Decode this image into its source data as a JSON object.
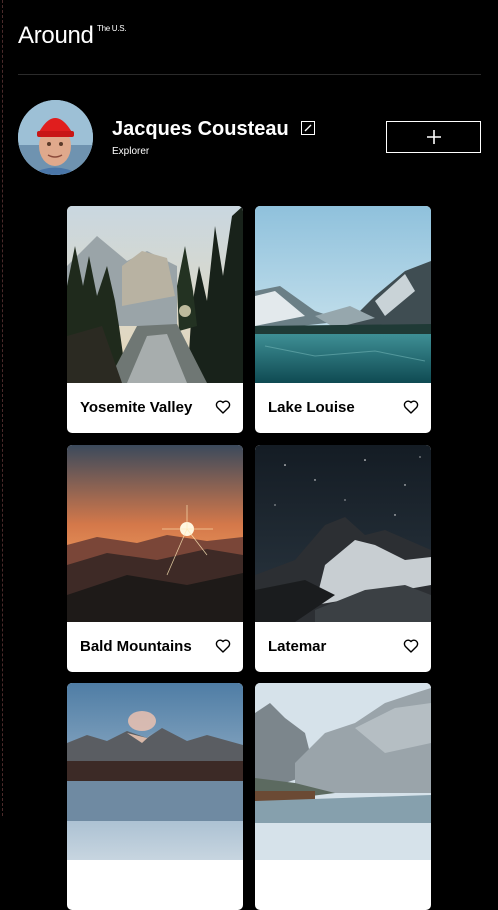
{
  "header": {
    "logo": "Around",
    "logo_sup": "The U.S."
  },
  "profile": {
    "name": "Jacques Cousteau",
    "role": "Explorer",
    "edit_icon": "edit-icon",
    "add_icon": "plus-icon"
  },
  "cards": [
    {
      "title": "Yosemite Valley",
      "like_icon": "heart-icon"
    },
    {
      "title": "Lake Louise",
      "like_icon": "heart-icon"
    },
    {
      "title": "Bald Mountains",
      "like_icon": "heart-icon"
    },
    {
      "title": "Latemar",
      "like_icon": "heart-icon"
    },
    {
      "title": "",
      "like_icon": "heart-icon"
    },
    {
      "title": "",
      "like_icon": "heart-icon"
    }
  ],
  "colors": {
    "background": "#000000",
    "card": "#ffffff",
    "text": "#ffffff",
    "card_text": "#000000"
  }
}
